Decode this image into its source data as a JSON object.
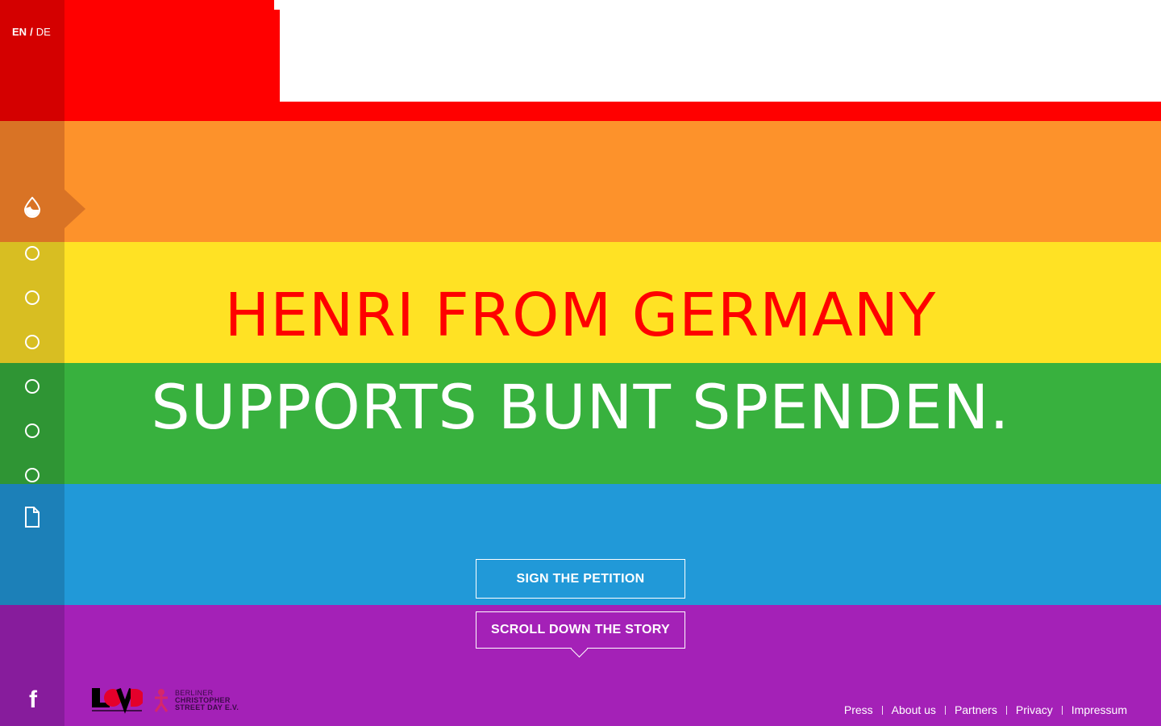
{
  "colors": {
    "red": "#ff0000",
    "orange": "#fd922b",
    "yellow": "#ffe224",
    "green": "#38b13e",
    "blue": "#2199d8",
    "purple": "#a421b7"
  },
  "language": {
    "active": "EN",
    "separator": "/",
    "other": "DE"
  },
  "nav": {
    "items": [
      {
        "icon": "drop-icon",
        "active": true
      },
      {
        "icon": "circle-icon"
      },
      {
        "icon": "circle-icon"
      },
      {
        "icon": "circle-icon"
      },
      {
        "icon": "circle-icon"
      },
      {
        "icon": "circle-icon"
      },
      {
        "icon": "circle-icon"
      },
      {
        "icon": "document-icon"
      }
    ]
  },
  "hero": {
    "line1": "HENRI FROM GERMANY",
    "line2": "SUPPORTS BUNT SPENDEN."
  },
  "buttons": {
    "petition": "SIGN THE PETITION",
    "scroll": "SCROLL DOWN THE STORY"
  },
  "logos": {
    "csd_line1": "BERLINER",
    "csd_line2": "CHRISTOPHER",
    "csd_line3": "STREET DAY E.V."
  },
  "footer": {
    "links": [
      "Press",
      "About us",
      "Partners",
      "Privacy",
      "Impressum"
    ]
  },
  "social": {
    "facebook_icon": "facebook-icon"
  }
}
